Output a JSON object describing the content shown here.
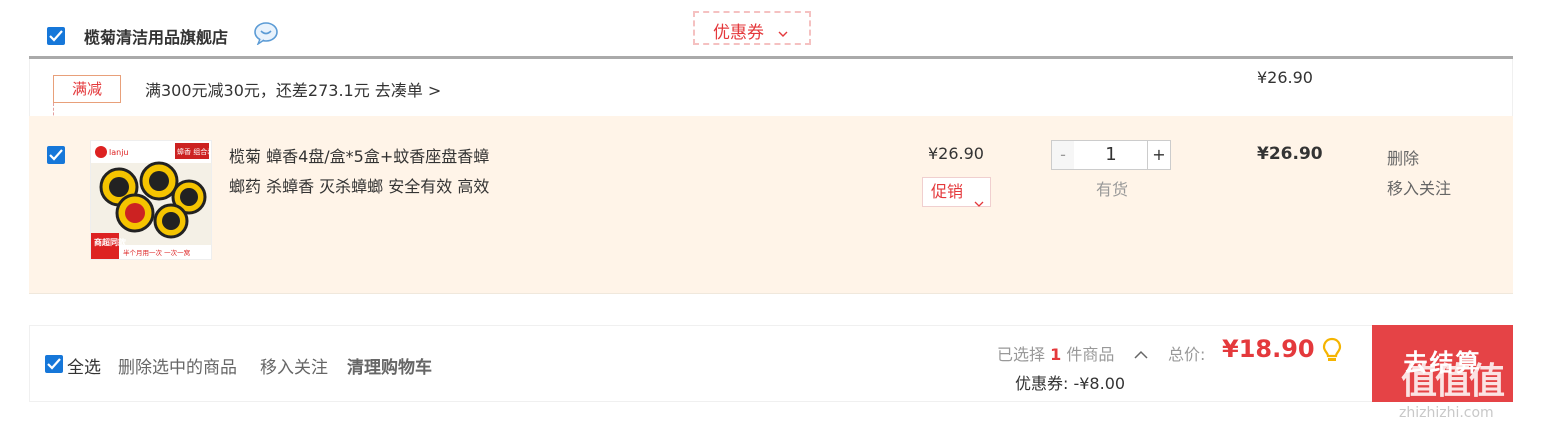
{
  "store": {
    "name": "榄菊清洁用品旗舰店",
    "coupon_label": "优惠券"
  },
  "promotion": {
    "tag": "满减",
    "text": "满300元减30元，还差273.1元",
    "link": "去凑单 >",
    "group_total": "¥26.90"
  },
  "item": {
    "title": "榄菊 蟑香4盘/盒*5盒+蚊香座盘香蟑螂药 杀蟑香 灭杀蟑螂 安全有效 高效",
    "title_line1": "榄菊 蟑香4盘/盒*5盒+蚊香座盘香蟑",
    "title_line2": "螂药 杀蟑香 灭杀蟑螂 安全有效 高效",
    "unit_price": "¥26.90",
    "promo_select": "促销",
    "qty_minus": "-",
    "quantity": "1",
    "qty_plus": "+",
    "stock_status": "有货",
    "subtotal": "¥26.90",
    "action_delete": "删除",
    "action_favorite": "移入关注"
  },
  "thumbnail_text": {
    "brand": "lanju",
    "badge": "蟑香 组合装",
    "corner": "商超同款",
    "slogan": "半个月用一次 一次一窝"
  },
  "footer": {
    "select_all": "全选",
    "delete_selected": "删除选中的商品",
    "move_to_favorites": "移入关注",
    "clear_cart": "清理购物车",
    "selected_prefix": "已选择",
    "selected_count": "1",
    "selected_suffix": "件商品",
    "total_label": "总价:",
    "total_value": "¥18.90",
    "coupon_discount": "优惠券: -¥8.00",
    "checkout": "去结算"
  },
  "watermark": {
    "logo": "值值值",
    "url": "zhizhizhi.com"
  },
  "colors": {
    "accent_red": "#e4393c",
    "checkbox_blue": "#1677d9",
    "item_bg": "#fff4e8",
    "checkout_bg": "#e54346"
  },
  "icons": {
    "store_chat": "chat-bubble-icon",
    "coupon_dropdown": "chevron-down-icon",
    "selected_expand": "chevron-up-icon",
    "total_tip": "lightbulb-icon"
  }
}
